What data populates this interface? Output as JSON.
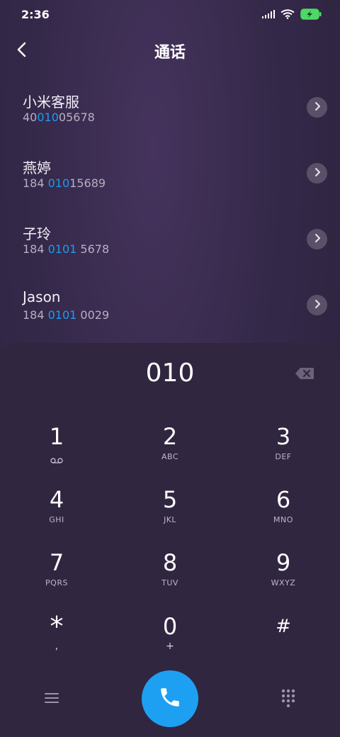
{
  "status_bar": {
    "time": "2:36"
  },
  "header": {
    "title": "通话"
  },
  "contacts": [
    {
      "name": "小米客服",
      "number_pre": "40",
      "number_match": "010",
      "number_post": "05678"
    },
    {
      "name": "燕婷",
      "number_pre": "184 ",
      "number_match": "010",
      "number_post": "15689"
    },
    {
      "name": "子玲",
      "number_pre": "184 ",
      "number_match": "0101",
      "number_post": " 5678"
    },
    {
      "name": "Jason",
      "number_pre": "184 ",
      "number_match": "0101",
      "number_post": " 0029"
    }
  ],
  "dialpad": {
    "display": "010",
    "keys": [
      {
        "digit": "1",
        "letters": ""
      },
      {
        "digit": "2",
        "letters": "ABC"
      },
      {
        "digit": "3",
        "letters": "DEF"
      },
      {
        "digit": "4",
        "letters": "GHI"
      },
      {
        "digit": "5",
        "letters": "JKL"
      },
      {
        "digit": "6",
        "letters": "MNO"
      },
      {
        "digit": "7",
        "letters": "PQRS"
      },
      {
        "digit": "8",
        "letters": "TUV"
      },
      {
        "digit": "9",
        "letters": "WXYZ"
      },
      {
        "digit": "*",
        "letters": ","
      },
      {
        "digit": "0",
        "letters": "+"
      },
      {
        "digit": "#",
        "letters": ""
      }
    ]
  },
  "colors": {
    "accent": "#1ea0f2",
    "match_highlight": "#1e9bf0",
    "battery": "#4cd964"
  },
  "icons": {
    "back": "chevron-left-icon",
    "arrow": "chevron-right-icon",
    "voicemail": "voicemail-icon",
    "delete": "backspace-icon",
    "menu": "menu-icon",
    "call": "phone-icon",
    "keypad": "dialpad-icon"
  }
}
